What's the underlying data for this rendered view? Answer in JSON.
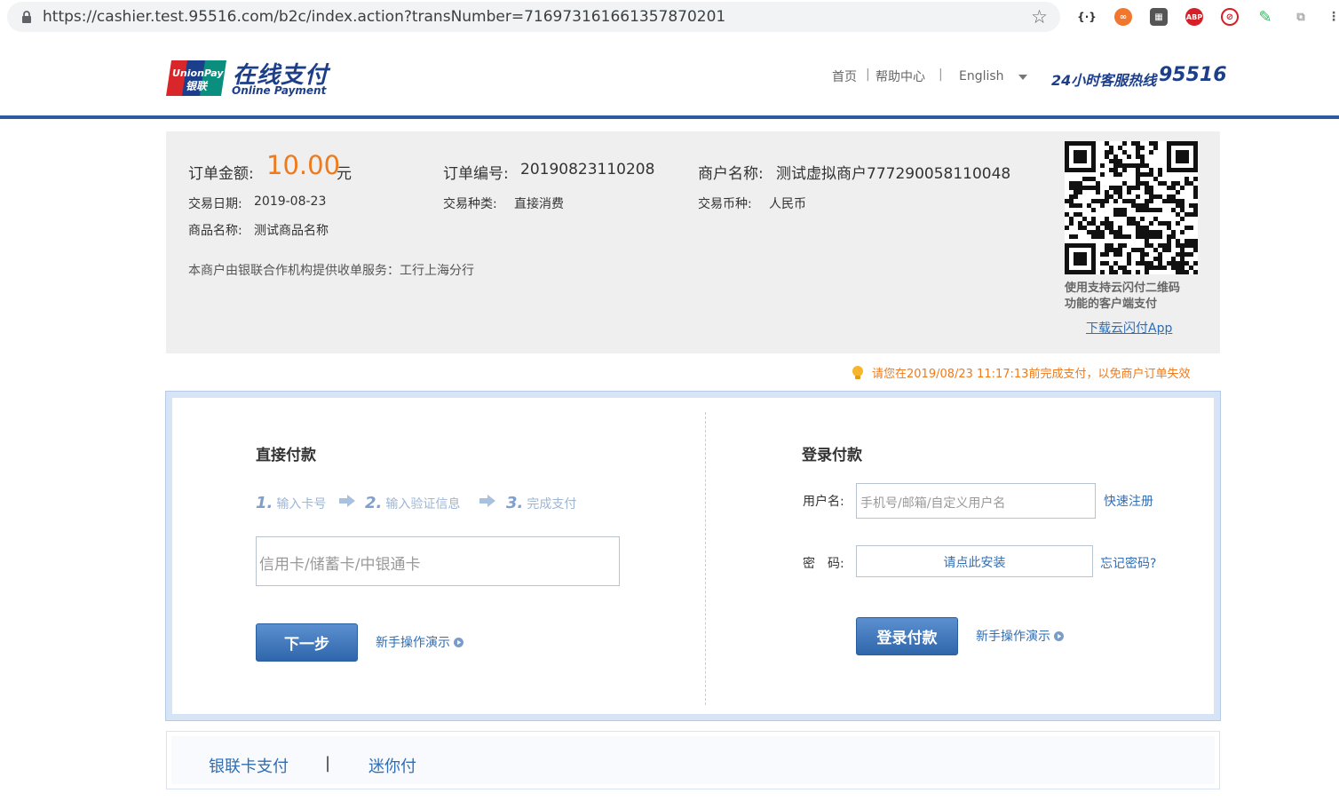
{
  "browser": {
    "url": "https://cashier.test.95516.com/b2c/index.action?transNumber=716973161661357870201"
  },
  "header": {
    "logo_card_top": "UnionPay",
    "logo_card_bottom": "银联",
    "title": "在线支付",
    "subtitle": "Online Payment",
    "nav": {
      "home": "首页",
      "sep1": "|",
      "help": "帮助中心",
      "sep2": "|",
      "language": "English"
    },
    "hotline_label": "24小时客服热线",
    "hotline_number": "95516"
  },
  "order": {
    "amount_label": "订单金额:",
    "amount_value": "10.00",
    "amount_unit": "元",
    "order_no_label": "订单编号:",
    "order_no_value": "20190823110208",
    "merchant_label": "商户名称:",
    "merchant_value": "测试虚拟商户777290058110048",
    "date_label": "交易日期:",
    "date_value": "2019-08-23",
    "type_label": "交易种类:",
    "type_value": "直接消费",
    "currency_label": "交易币种:",
    "currency_value": "人民币",
    "goods_label": "商品名称:",
    "goods_value": "测试商品名称",
    "acquirer_text": "本商户由银联合作机构提供收单服务：工行上海分行",
    "qr_caption_line1": "使用支持云闪付二维码",
    "qr_caption_line2": "功能的客户端支付",
    "qr_download": "下载云闪付App"
  },
  "warning": "请您在2019/08/23 11:17:13前完成支付，以免商户订单失效",
  "direct_pay": {
    "title": "直接付款",
    "steps": [
      {
        "num": "1.",
        "label": "输入卡号"
      },
      {
        "num": "2.",
        "label": "输入验证信息"
      },
      {
        "num": "3.",
        "label": "完成支付"
      }
    ],
    "card_placeholder": "信用卡/储蓄卡/中银通卡",
    "next_button": "下一步",
    "demo_link": "新手操作演示"
  },
  "login_pay": {
    "title": "登录付款",
    "username_label": "用户名:",
    "username_placeholder": "手机号/邮箱/自定义用户名",
    "register_link": "快速注册",
    "password_label": "密　码:",
    "password_install": "请点此安装",
    "forgot_link": "忘记密码?",
    "login_button": "登录付款",
    "demo_link": "新手操作演示"
  },
  "bottom_tabs": {
    "tab1": "银联卡支付",
    "separator": "|",
    "tab2": "迷你付"
  },
  "colors": {
    "brand_blue": "#1d3f8a",
    "link_blue": "#2f6eb5",
    "orange": "#ef7a1c"
  }
}
